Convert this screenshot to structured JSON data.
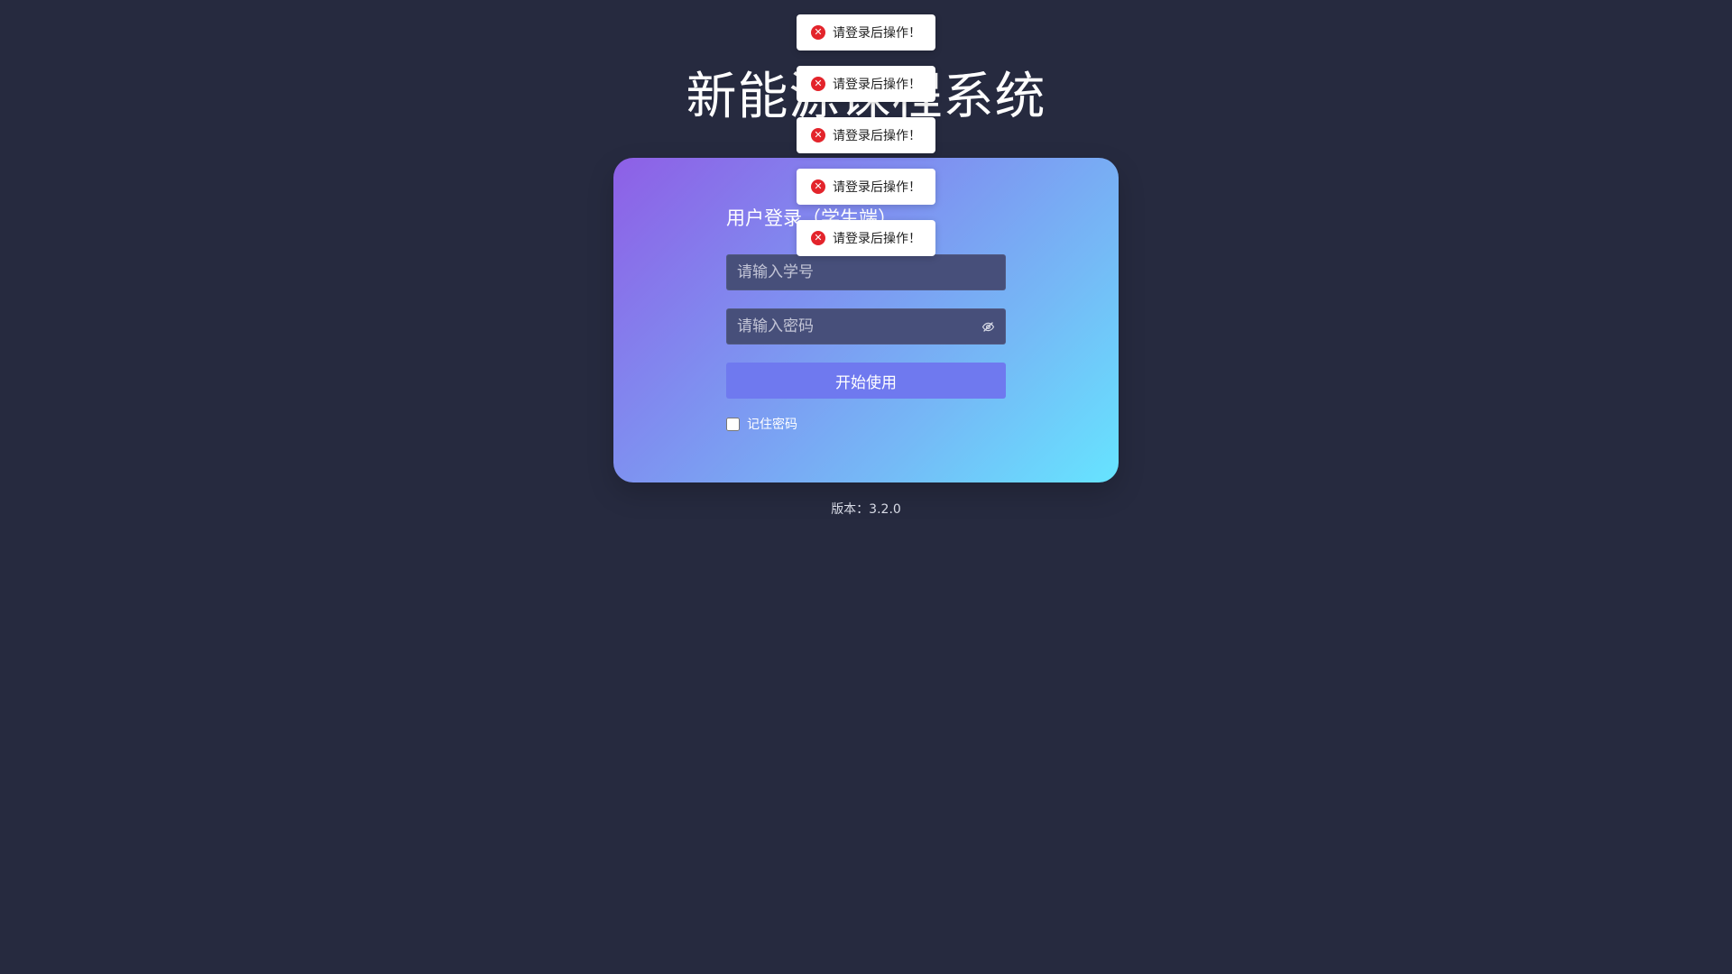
{
  "app": {
    "title": "新能源课程系统"
  },
  "login": {
    "heading": "用户登录（学生端）",
    "username_placeholder": "请输入学号",
    "password_placeholder": "请输入密码",
    "password_visibility_icon": "eye-off-icon",
    "submit_label": "开始使用",
    "remember_label": "记住密码"
  },
  "footer": {
    "version": "版本：3.2.0"
  },
  "notifications": [
    {
      "message": "请登录后操作！",
      "icon": "error-icon",
      "icon_glyph": "✕"
    },
    {
      "message": "请登录后操作！",
      "icon": "error-icon",
      "icon_glyph": "✕"
    },
    {
      "message": "请登录后操作！",
      "icon": "error-icon",
      "icon_glyph": "✕"
    },
    {
      "message": "请登录后操作！",
      "icon": "error-icon",
      "icon_glyph": "✕"
    },
    {
      "message": "请登录后操作！",
      "icon": "error-icon",
      "icon_glyph": "✕"
    }
  ],
  "colors": {
    "page_background": "#262a3f",
    "input_background": "#474f7a",
    "button_background": "#6f79ef",
    "error": "#e3242b",
    "gradient_start": "#8e5fe6",
    "gradient_end": "#66e4ff"
  }
}
